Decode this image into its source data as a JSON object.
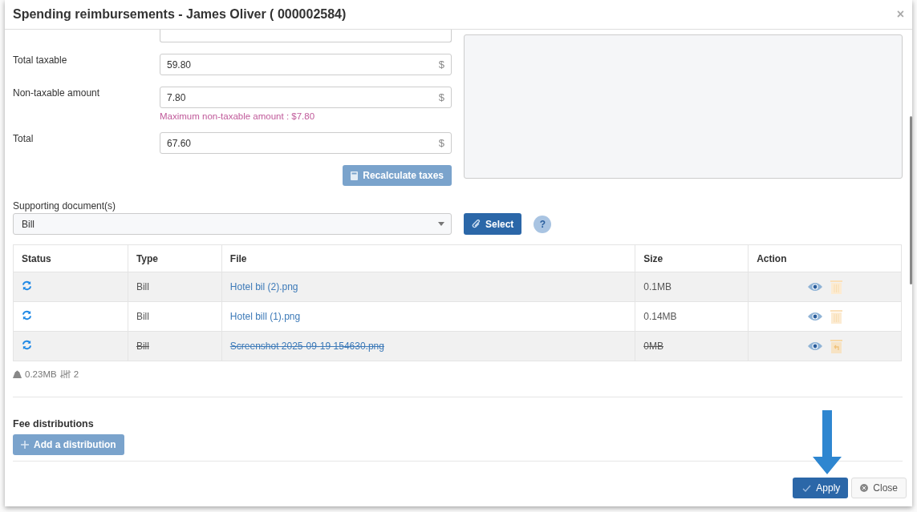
{
  "dialog": {
    "title": "Spending reimbursements - James Oliver ( 000002584)",
    "close_icon": "×"
  },
  "amounts": [
    {
      "label": "Total taxable",
      "value": "59.80",
      "unit": "$"
    },
    {
      "label": "Non-taxable amount",
      "value": "7.80",
      "unit": "$",
      "hint": "Maximum non-taxable amount : $7.80"
    },
    {
      "label": "Total",
      "value": "67.60",
      "unit": "$"
    }
  ],
  "recalculate_button": "Recalculate taxes",
  "supporting_documents": {
    "label": "Supporting document(s)",
    "value": "Bill",
    "select_button": "Select",
    "help": "?"
  },
  "table": {
    "columns": [
      "Status",
      "Type",
      "File",
      "Size",
      "Action"
    ],
    "rows": [
      {
        "type": "Bill",
        "file": "Hotel bil (2).png",
        "size": "0.1MB",
        "deleted": false
      },
      {
        "type": "Bill",
        "file": "Hotel bill (1).png",
        "size": "0.14MB",
        "deleted": false
      },
      {
        "type": "Bill",
        "file": "Screenshot 2025-09-19 154630.png",
        "size": "0MB",
        "deleted": true
      }
    ]
  },
  "summary": {
    "total_size": "0.23MB",
    "count": "2"
  },
  "fee_distributions": {
    "title": "Fee distributions",
    "add_button": "Add a distribution"
  },
  "footer": {
    "apply": "Apply",
    "close": "Close"
  }
}
